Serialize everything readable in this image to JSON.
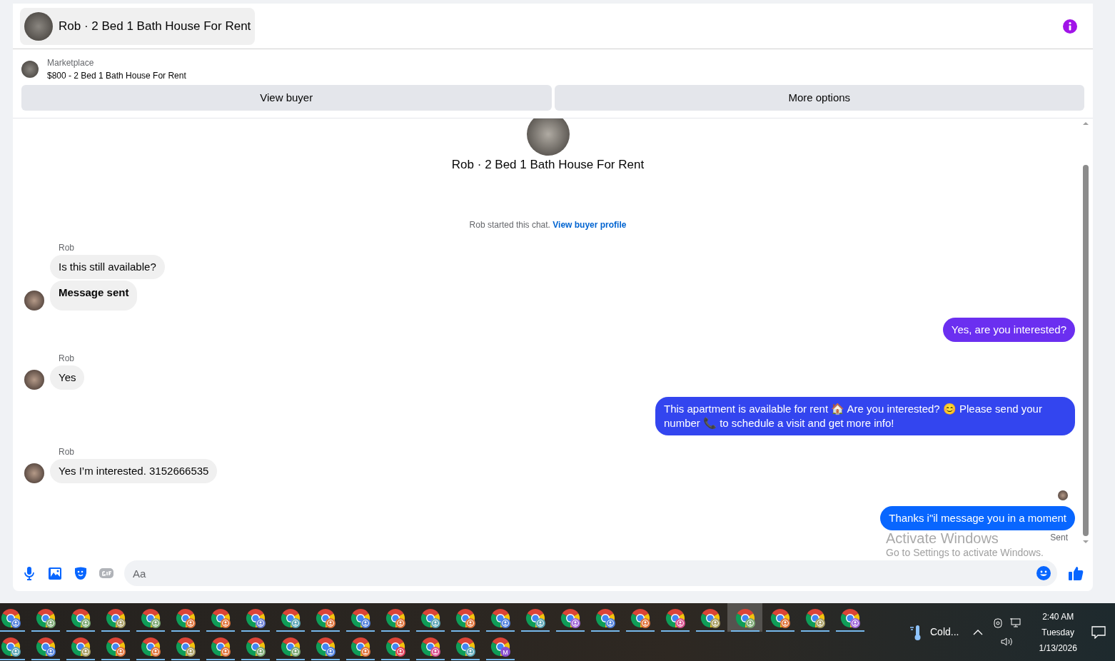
{
  "header": {
    "title": "Rob · 2 Bed 1 Bath House For Rent"
  },
  "listing": {
    "source": "Marketplace",
    "title": "$800 - 2 Bed 1 Bath House For Rent"
  },
  "actions": [
    "View buyer",
    "More options"
  ],
  "chat_intro": {
    "title": "Rob · 2 Bed 1 Bath House For Rent",
    "note": "Rob started this chat.",
    "link": "View buyer profile"
  },
  "messages": [
    {
      "kind": "name",
      "text": "Rob"
    },
    {
      "kind": "in",
      "text": "Is this still available?",
      "avatar": false,
      "bold": false
    },
    {
      "kind": "in",
      "text": "Message sent",
      "avatar": true,
      "bold": true
    },
    {
      "kind": "out",
      "text": "Yes, are you interested?",
      "color": "#6b2ff0"
    },
    {
      "kind": "name",
      "text": "Rob"
    },
    {
      "kind": "in",
      "text": "Yes",
      "avatar": true,
      "bold": false
    },
    {
      "kind": "out",
      "text": "This apartment is available for rent 🏠 Are you interested? 😊 Please send your number 📞 to schedule a visit and get more info!",
      "color": "#3345ef"
    },
    {
      "kind": "name",
      "text": "Rob"
    },
    {
      "kind": "in",
      "text": "Yes I’m interested. 3152666535",
      "avatar": true,
      "bold": false
    },
    {
      "kind": "seen"
    },
    {
      "kind": "out",
      "text": "Thanks i\"il message you in a moment",
      "color": "#0866ff"
    },
    {
      "kind": "status",
      "text": "Sent"
    }
  ],
  "composer": {
    "placeholder": "Aa"
  },
  "os_notice": {
    "title": "Activate Windows",
    "subtitle": "Go to Settings to activate Windows."
  },
  "taskbar": {
    "rows": [
      [
        {
          "color": "#4f7fdc",
          "selected": false
        },
        {
          "color": "#7aa872",
          "selected": false
        },
        {
          "color": "#7aa872",
          "selected": false
        },
        {
          "color": "#a89d62",
          "selected": false
        },
        {
          "color": "#7aa872",
          "selected": false
        },
        {
          "color": "#e0733a",
          "selected": false
        },
        {
          "color": "#e0733a",
          "selected": false
        },
        {
          "color": "#6b7fd6",
          "selected": false
        },
        {
          "color": "#5aa5b5",
          "selected": false
        },
        {
          "color": "#e0733a",
          "selected": false
        },
        {
          "color": "#4f7fdc",
          "selected": false
        },
        {
          "color": "#e0733a",
          "selected": false
        },
        {
          "color": "#5aa5b5",
          "selected": false
        },
        {
          "color": "#e0733a",
          "selected": false
        },
        {
          "color": "#4f7fdc",
          "selected": false
        },
        {
          "color": "#5aa5b5",
          "selected": false
        },
        {
          "color": "#a066d8",
          "selected": false
        },
        {
          "color": "#4f7fdc",
          "selected": false
        },
        {
          "color": "#e0733a",
          "selected": false
        },
        {
          "color": "#d9508f",
          "selected": false
        },
        {
          "color": "#a89d62",
          "selected": false
        },
        {
          "color": "#7aa872",
          "selected": true
        },
        {
          "color": "#e0733a",
          "selected": false
        },
        {
          "color": "#a89d62",
          "selected": false
        },
        {
          "color": "#a066d8",
          "selected": false
        }
      ],
      [
        {
          "color": "#5aa5b5",
          "selected": false
        },
        {
          "color": "#4f7fdc",
          "selected": false
        },
        {
          "color": "#a89d62",
          "selected": false
        },
        {
          "color": "#e0733a",
          "selected": false
        },
        {
          "color": "#e0733a",
          "selected": false
        },
        {
          "color": "#a89d62",
          "selected": false
        },
        {
          "color": "#e0733a",
          "selected": false
        },
        {
          "color": "#7aa872",
          "selected": false
        },
        {
          "color": "#7aa872",
          "selected": false
        },
        {
          "color": "#4f7fdc",
          "selected": false
        },
        {
          "color": "#e0733a",
          "selected": false
        },
        {
          "color": "#e0405a",
          "selected": false
        },
        {
          "color": "#d9508f",
          "selected": false
        },
        {
          "color": "#5aa5b5",
          "selected": false
        },
        {
          "color": "#8a4fd0",
          "selected": false,
          "letter": "M"
        }
      ]
    ],
    "weather": "Cold...",
    "time": "2:40 AM",
    "day": "Tuesday",
    "date": "1/13/2026"
  }
}
